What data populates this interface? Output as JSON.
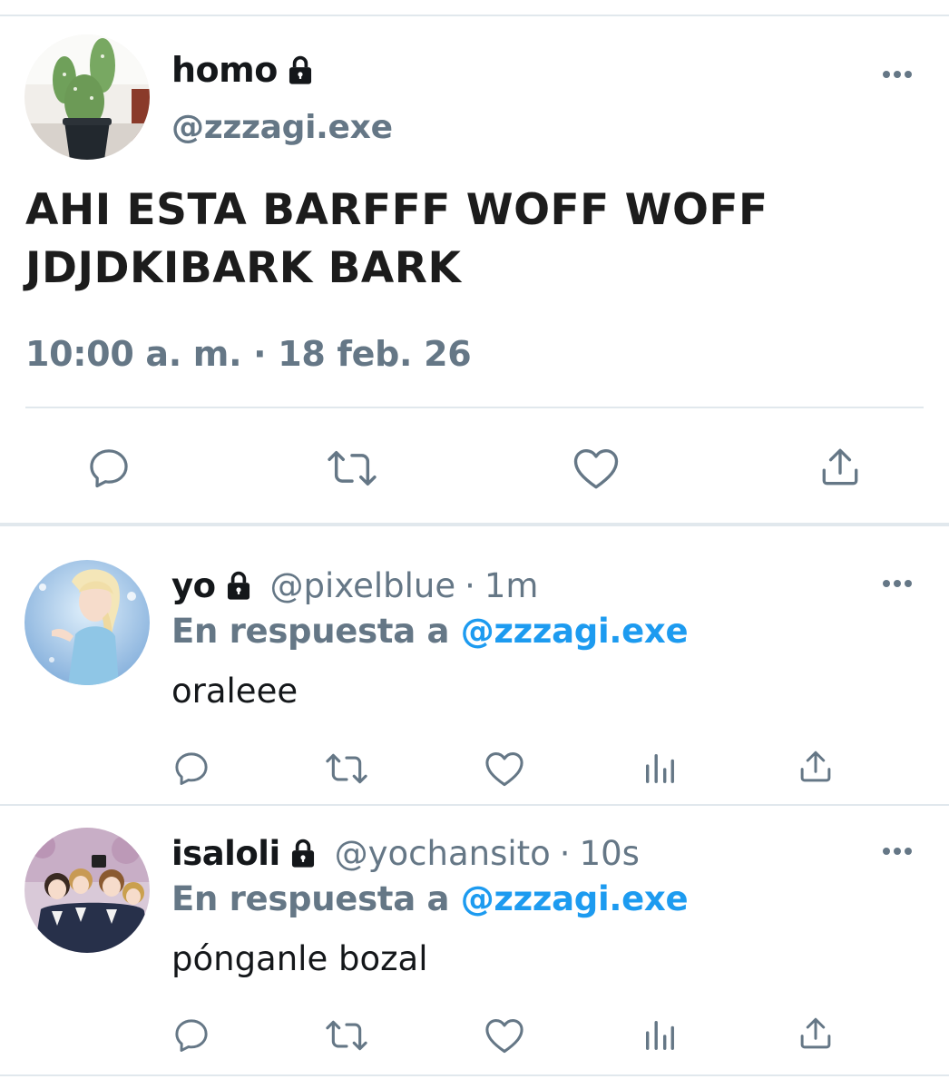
{
  "main_tweet": {
    "display_name": "homo",
    "handle": "@zzzagi.exe",
    "text_line1": "AHI ESTA BARFFF WOFF WOFF",
    "text_line2": "JDJDKIBARK BARK",
    "timestamp": "10:00 a. m. · 18 feb. 26",
    "avatar_icon": "cactus-avatar",
    "locked_icon": "lock-icon"
  },
  "replies": [
    {
      "display_name": "yo",
      "handle": "@pixelblue",
      "sep": "·",
      "time": "1m",
      "reply_prefix": "En respuesta a",
      "reply_mention": "@zzzagi.exe",
      "text": "oraleee",
      "avatar_icon": "princess-avatar"
    },
    {
      "display_name": "isaloli",
      "handle": "@yochansito",
      "sep": "·",
      "time": "10s",
      "reply_prefix": "En respuesta a",
      "reply_mention": "@zzzagi.exe",
      "text": "pónganle bozal",
      "avatar_icon": "anime-group-avatar"
    }
  ],
  "colors": {
    "primary_text": "#14171a",
    "secondary_text": "#657786",
    "mention": "#1d9bf0",
    "divider": "#e1e8ed"
  }
}
